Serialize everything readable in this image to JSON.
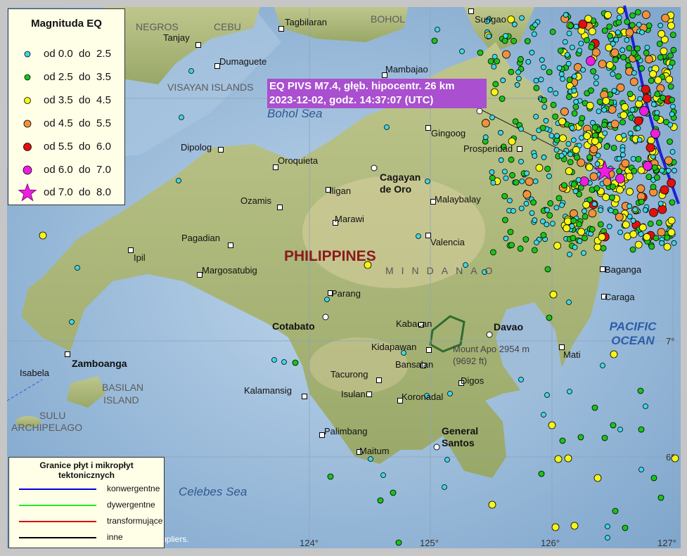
{
  "legend_magnitude": {
    "title": "Magnituda EQ",
    "items": [
      {
        "label": "od 0.0  do  2.5",
        "color": "#3fd6e6",
        "symbol": "circle-small"
      },
      {
        "label": "od 2.5  do  3.5",
        "color": "#19c419",
        "symbol": "circle-small"
      },
      {
        "label": "od 3.5  do  4.5",
        "color": "#f5f516",
        "symbol": "circle-small"
      },
      {
        "label": "od 4.5  do  5.5",
        "color": "#f0923c",
        "symbol": "circle-small"
      },
      {
        "label": "od 5.5  do  6.0",
        "color": "#e01010",
        "symbol": "circle-small"
      },
      {
        "label": "od 6.0  do  7.0",
        "color": "#ec1ee0",
        "symbol": "circle-small"
      },
      {
        "label": "od 7.0  do  8.0",
        "color": "#ec1ee0",
        "symbol": "star"
      }
    ]
  },
  "legend_plates": {
    "title_line1": "Granice płyt i mikropłyt",
    "title_line2": "tektonicznych",
    "items": [
      {
        "label": "konwergentne",
        "color": "#0000dd"
      },
      {
        "label": "dywergentne",
        "color": "#22ee22"
      },
      {
        "label": "transformujące",
        "color": "#dd0000"
      },
      {
        "label": "inne",
        "color": "#000000"
      }
    ]
  },
  "event": {
    "line1": "EQ PIVS M7.4, głęb. hipocentr. 26 km",
    "line2": "2023-12-02, godz. 14:37:07 (UTC)"
  },
  "places": {
    "surigao": "Surigao",
    "tagbilaran": "Tagbilaran",
    "tanjay": "Tanjay",
    "dumaguete": "Dumaguete",
    "mambajao": "Mambajao",
    "gingoog": "Gingoog",
    "prosperidad": "Prosperidad",
    "dipolog": "Dipolog",
    "oroquieta": "Oroquieta",
    "cagayan1": "Cagayan",
    "cagayan2": "de Oro",
    "iligan": "Iligan",
    "ozamis": "Ozamis",
    "malaybalay": "Malaybalay",
    "marawi": "Marawi",
    "pagadian": "Pagadian",
    "valencia": "Valencia",
    "ipil": "Ipil",
    "margosatubig": "Margosatubig",
    "parang": "Parang",
    "cotabato": "Cotabato",
    "kabacan": "Kabacan",
    "davao": "Davao",
    "kidapawan": "Kidapawan",
    "apo1": "Mount Apo 2954 m",
    "apo2": "(9692 ft)",
    "zamboanga": "Zamboanga",
    "isabela": "Isabela",
    "bansalan": "Bansalan",
    "tacurong": "Tacurong",
    "digos": "Digos",
    "kalamansig": "Kalamansig",
    "isulan": "Isulan",
    "koronadal": "Koronadal",
    "palimbang": "Palimbang",
    "maitum": "Maitum",
    "gensan1": "General",
    "gensan2": "Santos",
    "baganga": "Baganga",
    "caraga": "Caraga",
    "mati": "Mati"
  },
  "regions": {
    "negros": "NEGROS",
    "cebu": "CEBU",
    "bohol": "BOHOL",
    "visayan": "VISAYAN ISLANDS",
    "basilan1": "BASILAN",
    "basilan2": "ISLAND",
    "sulu1": "SULU",
    "sulu2": "ARCHIPELAGO",
    "mindanao": "MINDANAO",
    "philippines": "PHILIPPINES"
  },
  "seas": {
    "bohol_sea": "Bohol Sea",
    "celebes_sea": "Celebes Sea",
    "pacific1": "PACIFIC",
    "pacific2": "OCEAN"
  },
  "coords": {
    "lon124": "124°",
    "lon125": "125°",
    "lon126": "126°",
    "lon127": "127°",
    "lat7": "7°",
    "lat6": "6°"
  },
  "credit": "ppliers."
}
